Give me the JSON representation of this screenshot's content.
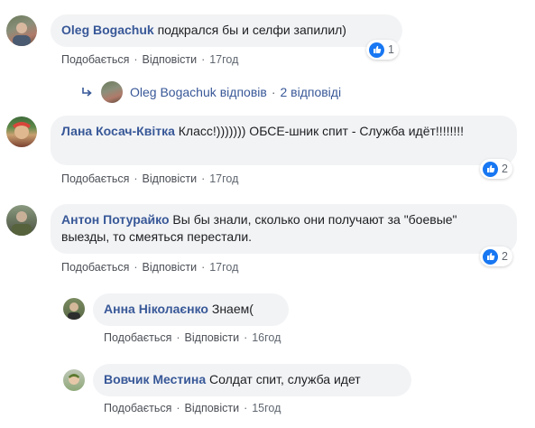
{
  "comments": [
    {
      "author": "Oleg Bogachuk",
      "text": "подкрался бы и селфи запилил)",
      "like": "Подобається",
      "reply": "Відповісти",
      "time": "17год",
      "reactions": "1"
    },
    {
      "author": "Лана Косач-Квітка",
      "text": "Класс!))))))) ОБСЕ-шник спит - Служба идёт!!!!!!!!",
      "like": "Подобається",
      "reply": "Відповісти",
      "time": "17год",
      "reactions": "2"
    },
    {
      "author": "Антон Потурайко",
      "text": "Вы бы знали, сколько они получают за \"боевые\" выезды, то смеяться перестали.",
      "like": "Подобається",
      "reply": "Відповісти",
      "time": "17год",
      "reactions": "2"
    }
  ],
  "replies_summary": {
    "author": "Oleg Bogachuk",
    "verb": "відповів",
    "count": "2 відповіді"
  },
  "replies": [
    {
      "author": "Анна Ніколаєнко",
      "text": "Знаем(",
      "like": "Подобається",
      "reply": "Відповісти",
      "time": "16год"
    },
    {
      "author": "Вовчик Местина",
      "text": "Солдат спит, служба идет",
      "like": "Подобається",
      "reply": "Відповісти",
      "time": "15год"
    }
  ],
  "separator": "·",
  "colors": {
    "author": "#385898",
    "bubble": "#f2f3f5",
    "like_blue": "#1877f2",
    "meta": "#606770"
  },
  "icons": {
    "reply_arrow": "reply-arrow-icon",
    "like": "thumbs-up-icon"
  }
}
